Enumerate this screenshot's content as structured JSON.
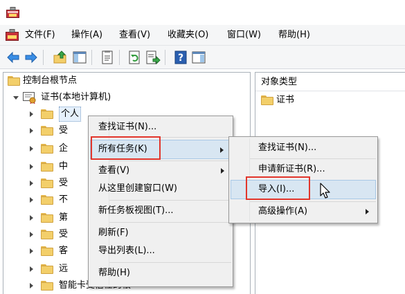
{
  "menubar": {
    "items": [
      "文件(F)",
      "操作(A)",
      "查看(V)",
      "收藏夹(O)",
      "窗口(W)",
      "帮助(H)"
    ]
  },
  "toolbar": {
    "icons": [
      "back-icon",
      "forward-icon",
      "up-folder-icon",
      "show-hide-tree-icon",
      "properties-icon",
      "refresh-icon",
      "export-list-icon",
      "help-icon",
      "action-pane-icon"
    ]
  },
  "tree": {
    "root": "控制台根节点",
    "certs": "证书(本地计算机)",
    "children": [
      "个人",
      "受",
      "企",
      "中",
      "受",
      "不",
      "第",
      "受",
      "客",
      "远",
      "智能卡受信任的根"
    ]
  },
  "right_pane": {
    "column_header": "对象类型",
    "items": [
      "证书"
    ]
  },
  "context_menu": {
    "items": [
      "查找证书(N)...",
      "所有任务(K)",
      "查看(V)",
      "从这里创建窗口(W)",
      "新任务板视图(T)...",
      "刷新(F)",
      "导出列表(L)...",
      "帮助(H)"
    ]
  },
  "submenu": {
    "items": [
      "查找证书(N)...",
      "申请新证书(R)...",
      "导入(I)...",
      "高级操作(A)"
    ]
  },
  "colors": {
    "highlight": "#d8e6f2",
    "annotation": "#e2352b",
    "folder": "#f3cf6a"
  }
}
